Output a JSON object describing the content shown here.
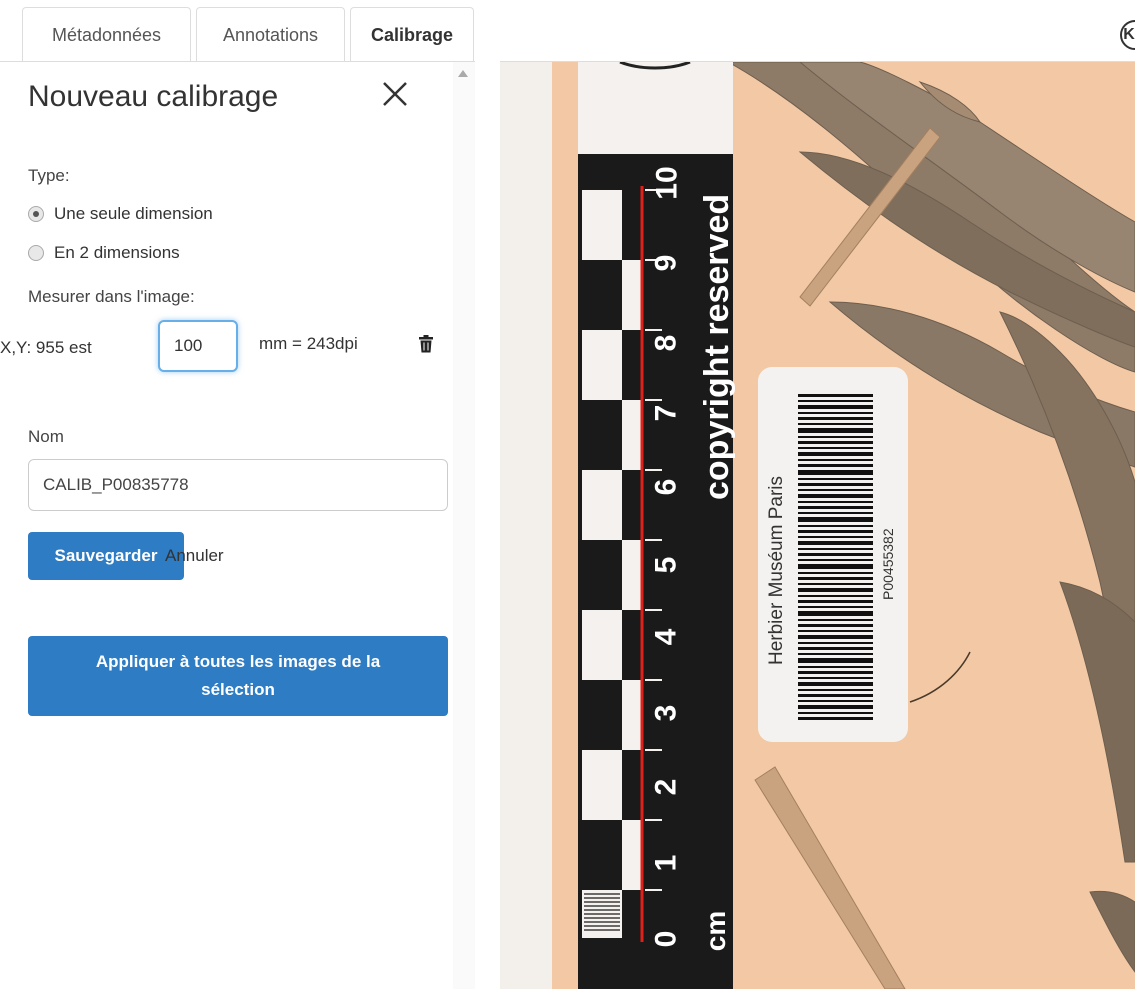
{
  "tabs": [
    {
      "label": "Métadonnées",
      "active": false
    },
    {
      "label": "Annotations",
      "active": false
    },
    {
      "label": "Calibrage",
      "active": true
    }
  ],
  "panel": {
    "title": "Nouveau calibrage",
    "type_label": "Type:",
    "type_options": [
      {
        "label": "Une seule dimension",
        "checked": true
      },
      {
        "label": "En 2 dimensions",
        "checked": false
      }
    ],
    "measure_label": "Mesurer dans l'image:",
    "xy_text": "X,Y: 955 est",
    "mm_value": "100",
    "mm_result": "mm = 243dpi",
    "name_label": "Nom",
    "name_value": "CALIB_P00835778",
    "save_label": "Sauvegarder",
    "cancel_label": "Annuler",
    "apply_label": "Appliquer à toutes les images de la sélection"
  },
  "viewer": {
    "nav_icon_label": "K",
    "ruler_numbers": [
      "10",
      "9",
      "8",
      "7",
      "6",
      "5",
      "4",
      "3",
      "2",
      "1",
      "0"
    ],
    "ruler_unit": "cm",
    "copyright_text": "copyright reserved",
    "barcode_label": "Herbier Muséum Paris",
    "barcode_number": "P00455382"
  },
  "colors": {
    "accent": "#2d7cc4",
    "paper": "#f3c9a5",
    "leaf": "#8d7b68",
    "ruler": "#1a1a1a"
  }
}
